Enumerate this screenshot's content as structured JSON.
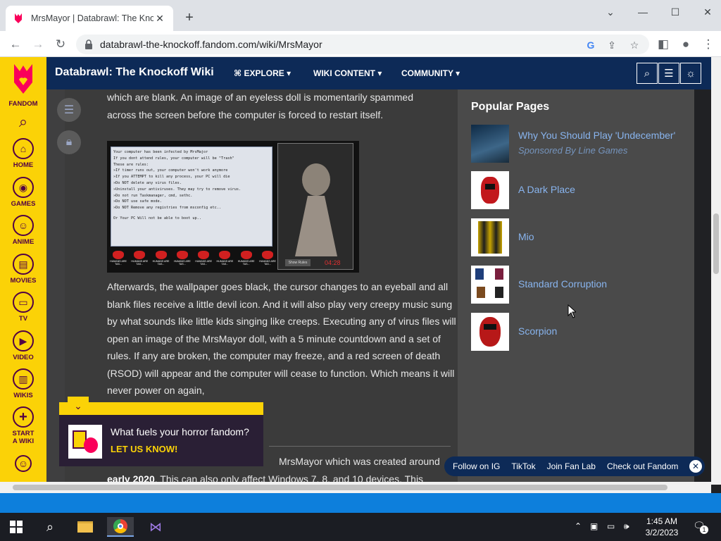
{
  "browser": {
    "tab_title": "MrsMayor | Databrawl: The Knockoff Wiki",
    "url": "databrawl-the-knockoff.fandom.com/wiki/MrsMayor"
  },
  "rail": {
    "brand": "FANDOM",
    "items": [
      {
        "label": "HOME",
        "icon": "home-icon"
      },
      {
        "label": "GAMES",
        "icon": "gamepad-icon"
      },
      {
        "label": "ANIME",
        "icon": "anime-icon"
      },
      {
        "label": "MOVIES",
        "icon": "film-icon"
      },
      {
        "label": "TV",
        "icon": "tv-icon"
      },
      {
        "label": "VIDEO",
        "icon": "play-icon"
      },
      {
        "label": "WIKIS",
        "icon": "book-icon"
      },
      {
        "label": "START A WIKI",
        "icon": "plus-icon"
      }
    ]
  },
  "wiki": {
    "name": "Databrawl: The Knockoff Wiki",
    "nav": [
      "EXPLORE",
      "WIKI CONTENT",
      "COMMUNITY"
    ]
  },
  "article": {
    "para1_line1": "which are blank. An image of an eyeless doll is momentarily spammed",
    "para1_line2": "across the screen before the computer is forced to restart itself.",
    "figure": {
      "dialog_lines": [
        "Your computer has been infected by MrsMajor",
        "If you dont attend rules, your computer will be \"Trash\"",
        "These are rules:",
        "»If timer runs out, your computer won't work anymore",
        "»If you ATTEMPT to kill any process, your PC will die",
        "»Do NOT delete any virus files.",
        "»Uninstall your antiviruses. They may try to remove virus.",
        "»Do not run Taskmanager, cmd, sethc.",
        "»Do NOT use safe mode.",
        "»Do NOT Remove any registries from msconfig etc..",
        "",
        "Or Your PC Will not be able to boot up.."
      ],
      "devil_caption": "HUMANS ARE TAS...",
      "show_rules": "Show Rules",
      "timer": "04:28"
    },
    "para2": "Afterwards, the wallpaper goes black, the cursor changes to an eyeball and all blank files receive a little devil icon. And it will also play very creepy music sung by what sounds like little kids singing like creeps. Executing any of virus files will open an image of the MrsMayor doll, with a 5 minute countdown and a set of rules. If any are broken, the computer may freeze, and a red screen of death (RSOD) will appear and the computer will cease to function. Which means it will never power on again,",
    "para3_line1_tail": "MrsMayor which was created around",
    "para3_line2_bold": "early 2020",
    "para3_line2_rest": ". This can also only affect Windows 7, 8, and 10 devices. This"
  },
  "sidebar": {
    "title": "Popular Pages",
    "items": [
      {
        "label": "Why You Should Play 'Undecember'",
        "sub": "Sponsored By Line Games"
      },
      {
        "label": "A Dark Place"
      },
      {
        "label": "Mio"
      },
      {
        "label": "Standard Corruption"
      },
      {
        "label": "Scorpion"
      }
    ]
  },
  "promo": {
    "question": "What fuels your horror fandom?",
    "cta": "LET US KNOW!"
  },
  "social": [
    "Follow on IG",
    "TikTok",
    "Join Fan Lab",
    "Check out Fandom"
  ],
  "taskbar": {
    "time": "1:45 AM",
    "date": "3/2/2023",
    "notifications": "1"
  },
  "colors": {
    "fandom_yellow": "#fbd207",
    "fandom_purple": "#520044",
    "wiki_header": "#0d2a57",
    "link": "#88b4ee"
  }
}
